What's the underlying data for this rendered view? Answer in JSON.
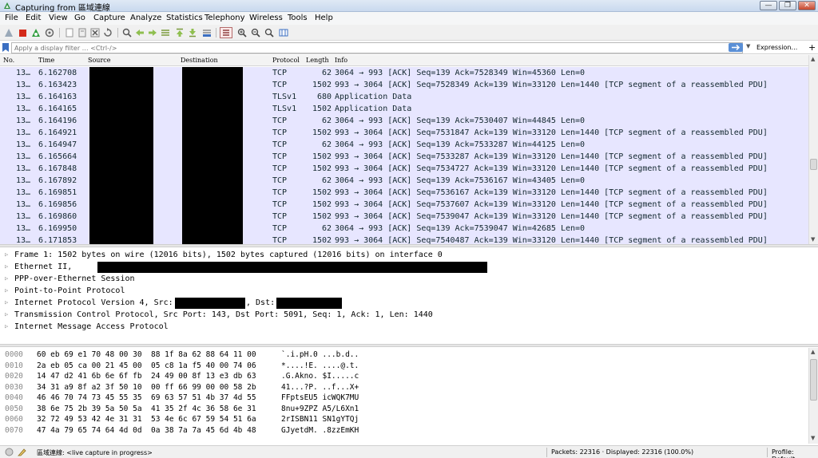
{
  "window": {
    "title": "Capturing from 區域連線",
    "controls": {
      "minimize": "—",
      "maximize": "❐",
      "close": "✕"
    }
  },
  "menu": [
    "File",
    "Edit",
    "View",
    "Go",
    "Capture",
    "Analyze",
    "Statistics",
    "Telephony",
    "Wireless",
    "Tools",
    "Help"
  ],
  "toolbar": {
    "icons": [
      "shark-fin-start-icon",
      "stop-capture-icon",
      "restart-capture-icon",
      "capture-options-icon",
      "open-file-icon",
      "save-file-icon",
      "close-file-icon",
      "reload-icon",
      "find-packet-icon",
      "go-back-icon",
      "go-forward-icon",
      "go-to-packet-icon",
      "go-first-icon",
      "go-last-icon",
      "autoscroll-icon",
      "colorize-icon",
      "zoom-in-icon",
      "zoom-out-icon",
      "zoom-normal-icon",
      "resize-columns-icon"
    ]
  },
  "filter": {
    "placeholder": "Apply a display filter … <Ctrl-/>",
    "expression_label": "Expression…",
    "add_label": "+"
  },
  "packet_list": {
    "columns": [
      "No.",
      "Time",
      "Source",
      "Destination",
      "Protocol",
      "Length",
      "Info"
    ],
    "rows": [
      {
        "no": "13…",
        "time": "6.162708",
        "src": "",
        "dst": "",
        "proto": "TCP",
        "len": "62",
        "info": "3064 → 993 [ACK] Seq=139 Ack=7528349 Win=45360 Len=0"
      },
      {
        "no": "13…",
        "time": "6.163423",
        "src": "",
        "dst": "",
        "proto": "TCP",
        "len": "1502",
        "info": "993 → 3064 [ACK] Seq=7528349 Ack=139 Win=33120 Len=1440 [TCP segment of a reassembled PDU]"
      },
      {
        "no": "13…",
        "time": "6.164163",
        "src": "",
        "dst": "",
        "proto": "TLSv1",
        "len": "680",
        "info": "Application Data"
      },
      {
        "no": "13…",
        "time": "6.164165",
        "src": "",
        "dst": "",
        "proto": "TLSv1",
        "len": "1502",
        "info": "Application Data"
      },
      {
        "no": "13…",
        "time": "6.164196",
        "src": "",
        "dst": "",
        "proto": "TCP",
        "len": "62",
        "info": "3064 → 993 [ACK] Seq=139 Ack=7530407 Win=44845 Len=0"
      },
      {
        "no": "13…",
        "time": "6.164921",
        "src": "",
        "dst": "",
        "proto": "TCP",
        "len": "1502",
        "info": "993 → 3064 [ACK] Seq=7531847 Ack=139 Win=33120 Len=1440 [TCP segment of a reassembled PDU]"
      },
      {
        "no": "13…",
        "time": "6.164947",
        "src": "",
        "dst": "",
        "proto": "TCP",
        "len": "62",
        "info": "3064 → 993 [ACK] Seq=139 Ack=7533287 Win=44125 Len=0"
      },
      {
        "no": "13…",
        "time": "6.165664",
        "src": "",
        "dst": "",
        "proto": "TCP",
        "len": "1502",
        "info": "993 → 3064 [ACK] Seq=7533287 Ack=139 Win=33120 Len=1440 [TCP segment of a reassembled PDU]"
      },
      {
        "no": "13…",
        "time": "6.167848",
        "src": "",
        "dst": "",
        "proto": "TCP",
        "len": "1502",
        "info": "993 → 3064 [ACK] Seq=7534727 Ack=139 Win=33120 Len=1440 [TCP segment of a reassembled PDU]"
      },
      {
        "no": "13…",
        "time": "6.167892",
        "src": "",
        "dst": "",
        "proto": "TCP",
        "len": "62",
        "info": "3064 → 993 [ACK] Seq=139 Ack=7536167 Win=43405 Len=0"
      },
      {
        "no": "13…",
        "time": "6.169851",
        "src": "",
        "dst": "",
        "proto": "TCP",
        "len": "1502",
        "info": "993 → 3064 [ACK] Seq=7536167 Ack=139 Win=33120 Len=1440 [TCP segment of a reassembled PDU]"
      },
      {
        "no": "13…",
        "time": "6.169856",
        "src": "",
        "dst": "",
        "proto": "TCP",
        "len": "1502",
        "info": "993 → 3064 [ACK] Seq=7537607 Ack=139 Win=33120 Len=1440 [TCP segment of a reassembled PDU]"
      },
      {
        "no": "13…",
        "time": "6.169860",
        "src": "",
        "dst": "",
        "proto": "TCP",
        "len": "1502",
        "info": "993 → 3064 [ACK] Seq=7539047 Ack=139 Win=33120 Len=1440 [TCP segment of a reassembled PDU]"
      },
      {
        "no": "13…",
        "time": "6.169950",
        "src": "",
        "dst": "",
        "proto": "TCP",
        "len": "62",
        "info": "3064 → 993 [ACK] Seq=139 Ack=7539047 Win=42685 Len=0"
      },
      {
        "no": "13…",
        "time": "6.171853",
        "src": "",
        "dst": "",
        "proto": "TCP",
        "len": "1502",
        "info": "993 → 3064 [ACK] Seq=7540487 Ack=139 Win=33120 Len=1440 [TCP segment of a reassembled PDU]"
      }
    ]
  },
  "details": [
    "Frame 1: 1502 bytes on wire (12016 bits), 1502 bytes captured (12016 bits) on interface 0",
    "Ethernet II,",
    "PPP-over-Ethernet Session",
    "Point-to-Point Protocol",
    "Internet Protocol Version 4, Src:",
    "Transmission Control Protocol, Src Port: 143, Dst Port: 5091, Seq: 1, Ack: 1, Len: 1440",
    "Internet Message Access Protocol"
  ],
  "details_dst_label": ", Dst:",
  "bytes": [
    {
      "offset": "0000",
      "hex": "60 eb 69 e1 70 48 00 30  88 1f 8a 62 88 64 11 00",
      "ascii": "`.i.pH.0 ...b.d.."
    },
    {
      "offset": "0010",
      "hex": "2a eb 05 ca 00 21 45 00  05 c8 1a f5 40 00 74 06",
      "ascii": "*....!E. ....@.t."
    },
    {
      "offset": "0020",
      "hex": "14 47 d2 41 6b 6e 6f fb  24 49 00 8f 13 e3 db 63",
      "ascii": ".G.Akno. $I.....c"
    },
    {
      "offset": "0030",
      "hex": "34 31 a9 8f a2 3f 50 10  00 ff 66 99 00 00 58 2b",
      "ascii": "41...?P. ..f...X+"
    },
    {
      "offset": "0040",
      "hex": "46 46 70 74 73 45 55 35  69 63 57 51 4b 37 4d 55",
      "ascii": "FFptsEU5 icWQK7MU"
    },
    {
      "offset": "0050",
      "hex": "38 6e 75 2b 39 5a 50 5a  41 35 2f 4c 36 58 6e 31",
      "ascii": "8nu+9ZPZ A5/L6Xn1"
    },
    {
      "offset": "0060",
      "hex": "32 72 49 53 42 4e 31 31  53 4e 6c 67 59 54 51 6a",
      "ascii": "2rISBN11 SN1gYTQj"
    },
    {
      "offset": "0070",
      "hex": "47 4a 79 65 74 64 4d 0d  0a 38 7a 7a 45 6d 4b 48",
      "ascii": "GJyetdM. .8zzEmKH"
    }
  ],
  "status": {
    "capture_text": "區域連線: <live capture in progress>",
    "packets_text": "Packets: 22316 · Displayed: 22316 (100.0%)",
    "profile_text": "Profile: Default"
  },
  "colors": {
    "row_background": "#e7e6ff",
    "row_text": "#12272e",
    "stop_button": "#d42a1a",
    "shark_fin": "#1f7fd6"
  }
}
